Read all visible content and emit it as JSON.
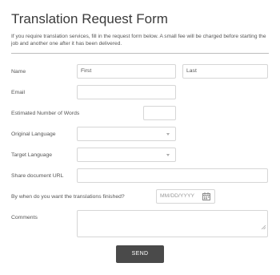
{
  "form": {
    "title": "Translation Request Form",
    "description": "If you require translation services, fill in the request form below. A small fee will be charged before starting the job and another one after it has been delivered."
  },
  "fields": {
    "name_label": "Name",
    "first_value": "First",
    "last_value": "Last",
    "email_label": "Email",
    "email_value": "",
    "word_count_label": "Estimated Number of Words",
    "word_count_value": "",
    "original_language_label": "Original Language",
    "original_language_value": "",
    "target_language_label": "Target Language",
    "target_language_value": "",
    "share_url_label": "Share document URL",
    "share_url_value": "",
    "deadline_label": "By when do you want the translations finished?",
    "deadline_placeholder": "MM/DD/YYYY",
    "comments_label": "Comments",
    "comments_value": ""
  },
  "actions": {
    "send_label": "SEND"
  },
  "icons": {
    "select_arrow": "chevron-down-icon",
    "date_picker": "calendar-icon",
    "resize": "resize-grip-icon"
  }
}
